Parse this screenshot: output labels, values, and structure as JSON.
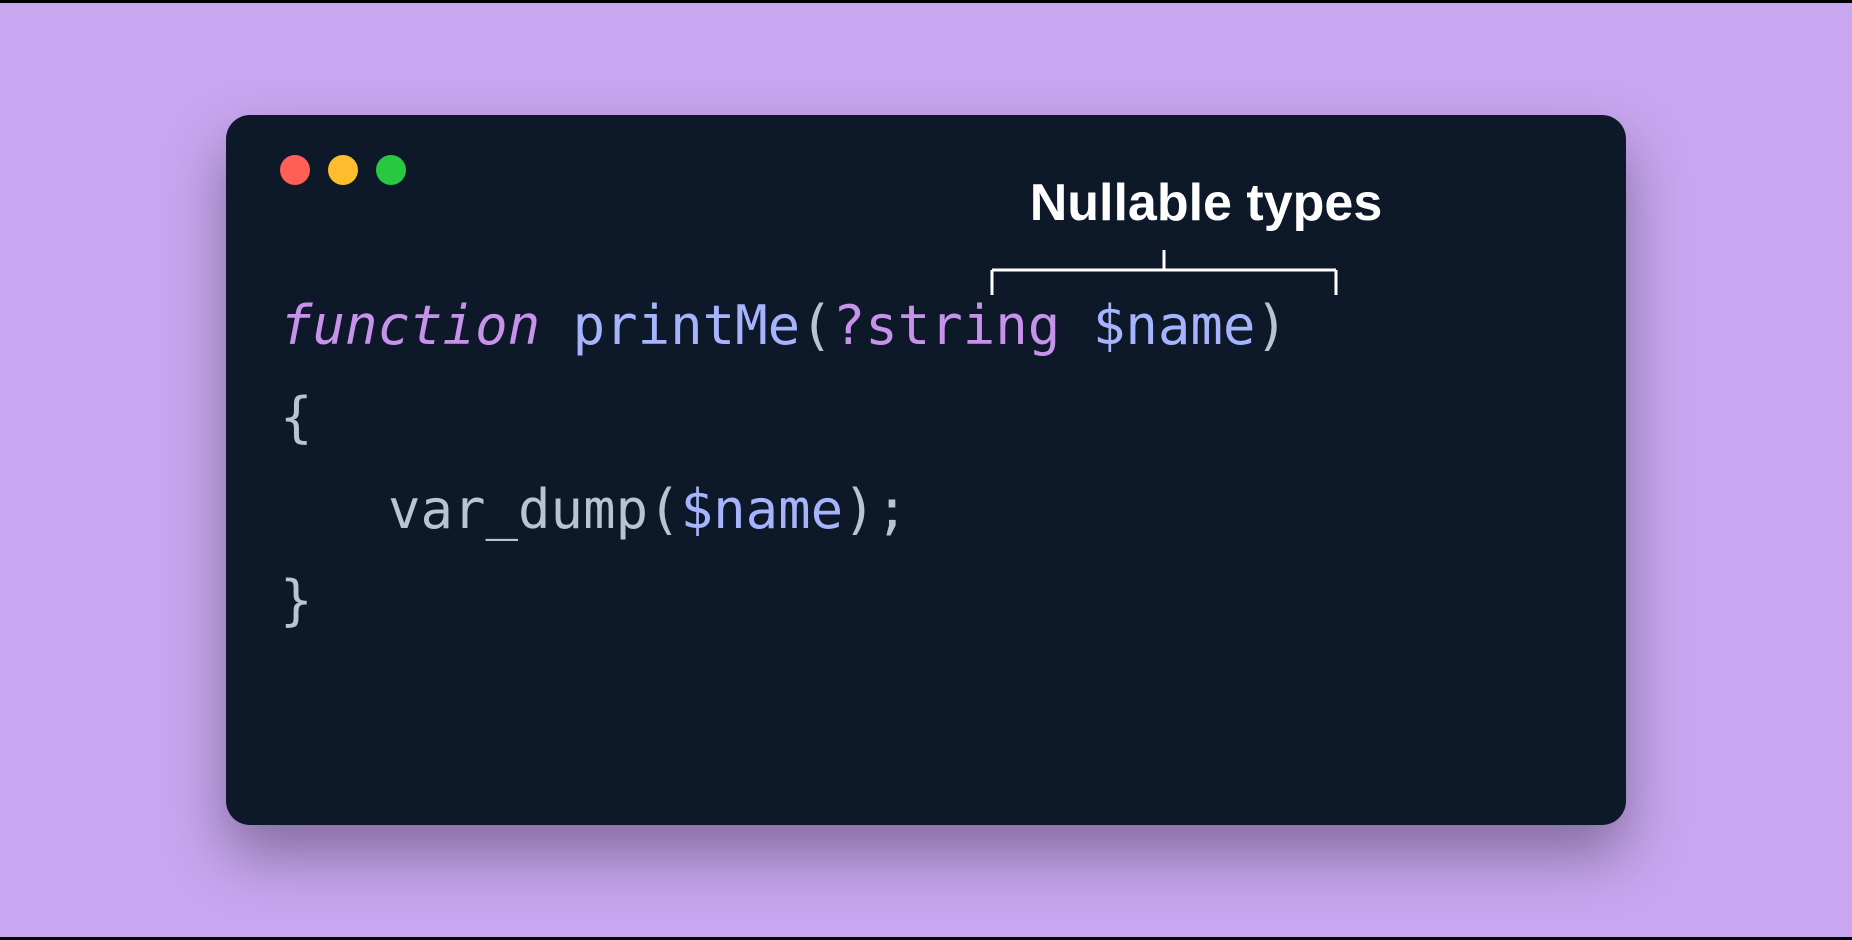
{
  "annotation": {
    "label": "Nullable types"
  },
  "code": {
    "line1": {
      "keyword": "function",
      "space1": " ",
      "functionName": "printMe",
      "openParen": "(",
      "nullable": "?",
      "type": "string",
      "space2": " ",
      "variable": "$name",
      "closeParen": ")"
    },
    "line2": {
      "openBrace": "{"
    },
    "line3": {
      "funcCall": "var_dump",
      "openParen": "(",
      "variable": "$name",
      "closeParen": ")",
      "semicolon": ";"
    },
    "line4": {
      "closeBrace": "}"
    }
  },
  "colors": {
    "background": "#c9a6f0",
    "windowBg": "#0d1929",
    "keyword": "#c792ea",
    "function": "#a5b4fc",
    "paren": "#b8c4d4",
    "annotation": "#ffffff"
  }
}
